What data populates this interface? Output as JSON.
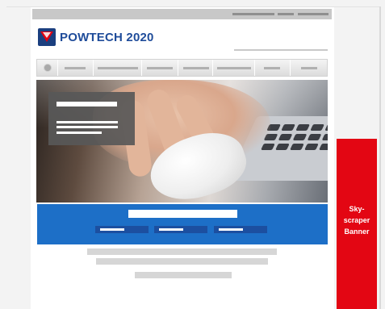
{
  "brand": {
    "name": "POWTECH 2020"
  },
  "banner": {
    "line1": "Sky-",
    "line2": "scraper",
    "line3": "Banner"
  },
  "colors": {
    "promo_blue": "#1d6fc7",
    "banner_red": "#e30613",
    "brand_blue": "#1f4c9a",
    "logo_red": "#e3000f"
  },
  "icons": {
    "home": "home-icon",
    "logo": "powtech-logo-icon"
  }
}
